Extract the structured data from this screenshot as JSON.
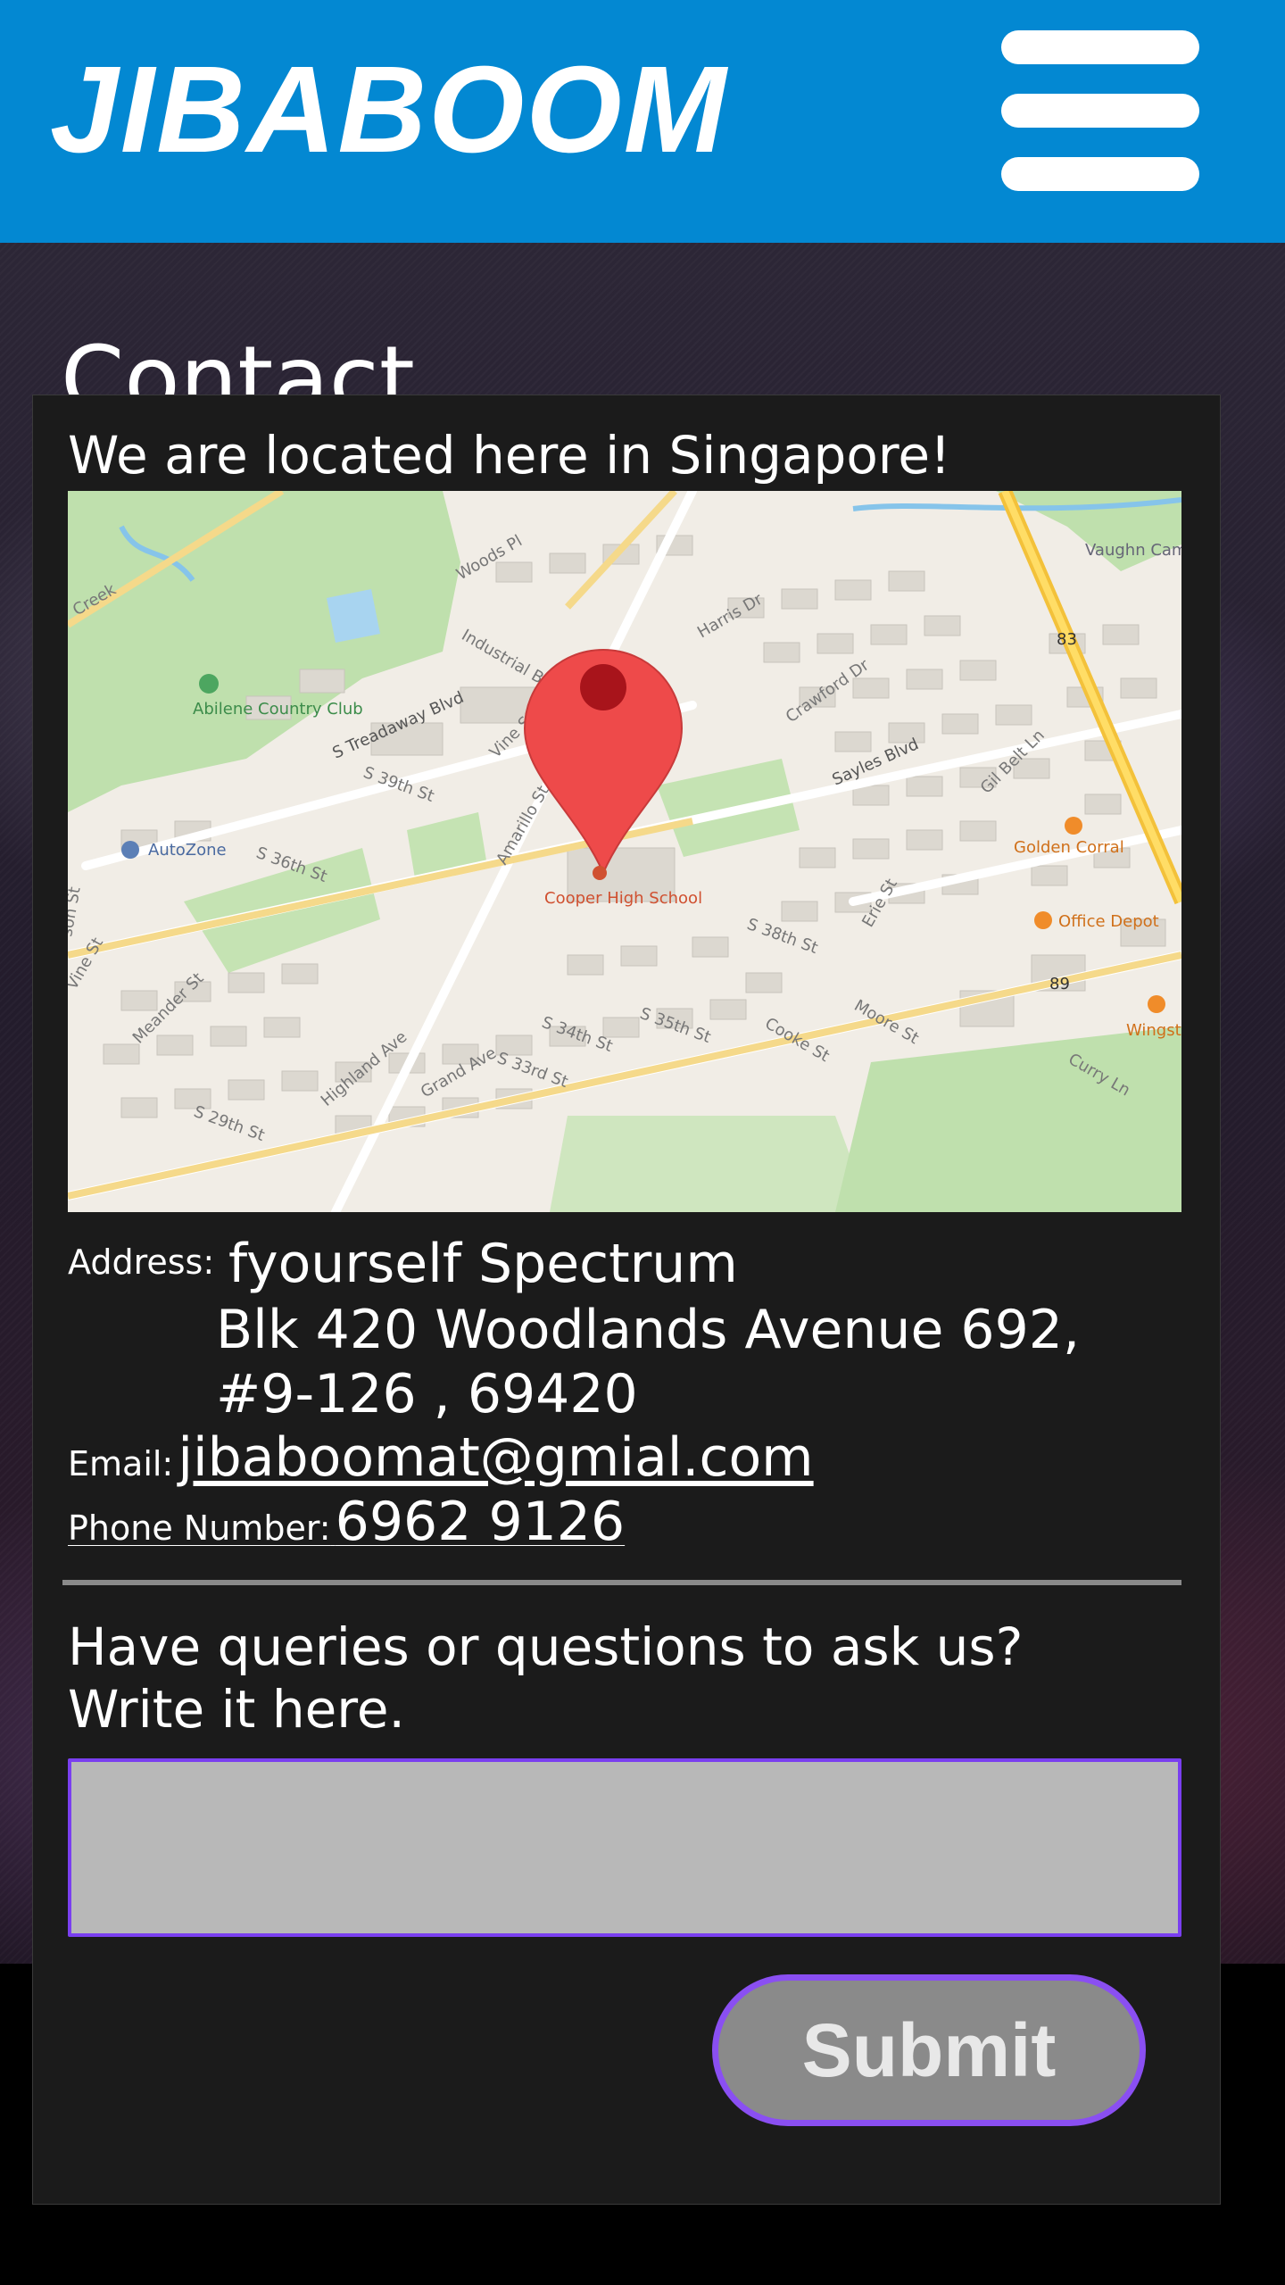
{
  "header": {
    "brand": "JIBABOOM",
    "menu_icon": "hamburger-menu-icon",
    "background_color": "#0388d2"
  },
  "page": {
    "title": "Contact"
  },
  "location": {
    "heading": "We are located here in Singapore!",
    "map_icon": "map-pin-icon",
    "map_labels": {
      "country_club": "Abilene Country Club",
      "autozone": "AutoZone",
      "school": "Cooper High School",
      "golden_corral": "Golden Corral",
      "office_depot": "Office Depot",
      "wingstop": "Wingsto",
      "vaughn": "Vaughn Camp",
      "hwy83": "83",
      "hwy89": "89",
      "s_treadaway": "S Treadaway Blvd",
      "sayles": "Sayles Blvd",
      "s36": "S 36th St",
      "s39": "S 39th St",
      "s35": "S 35th St",
      "s34": "S 34th St",
      "s33": "S 33rd St",
      "s38": "S 38th St",
      "s29": "S 29th St",
      "amarillo": "Amarillo St",
      "highland": "Highland Ave",
      "grand": "Grand Ave",
      "harris": "Harris Dr",
      "crawford": "Crawford Dr",
      "woods": "Woods Pl",
      "industrial": "Industrial Blvd",
      "vine": "Vine St",
      "meander": "Meander St",
      "cooke": "Cooke St",
      "moore": "Moore St",
      "erie": "Erie St",
      "curry": "Curry Ln",
      "gilbelt": "Gil Belt Ln",
      "creek": "Creek",
      "vine2": "Vine St",
      "sonst": "son St"
    }
  },
  "contact": {
    "address_label": "Address:",
    "address_line1": "fyourself Spectrum",
    "address_line2": "Blk 420 Woodlands Avenue 692,",
    "address_line3": "#9-126 , 69420",
    "email_label": "Email:",
    "email": "jibaboomat@gmial.com",
    "phone_label": "Phone Number:",
    "phone": "6962 9126"
  },
  "form": {
    "prompt": "Have queries or questions to ask us? Write it here.",
    "textarea_value": "",
    "submit_label": "Submit"
  }
}
